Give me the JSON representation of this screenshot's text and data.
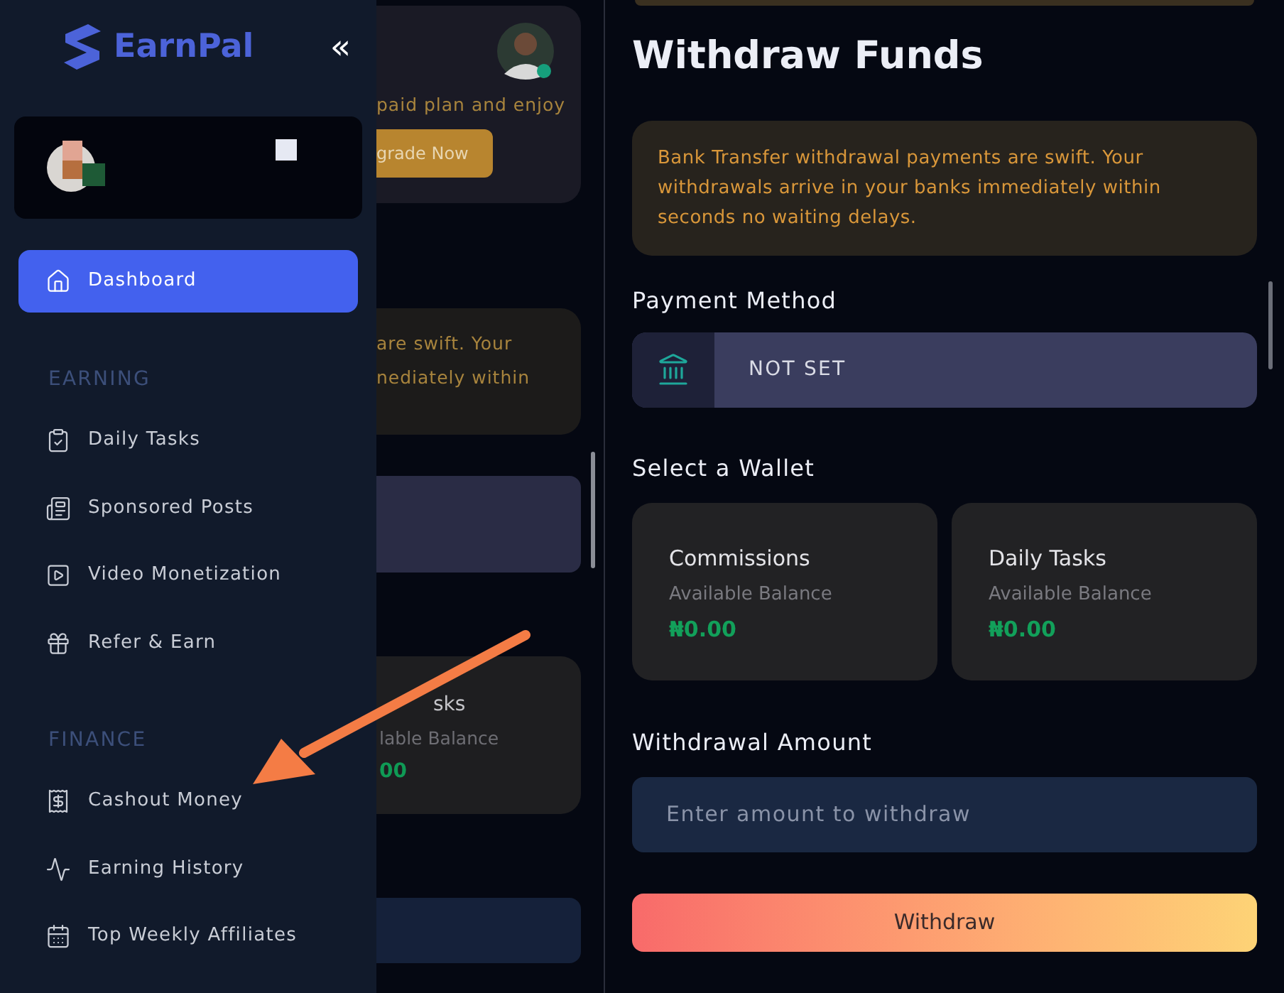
{
  "sidebar": {
    "brand": "EarnPal",
    "collapse_glyph": "«",
    "items": [
      {
        "kind": "item",
        "label": "Dashboard",
        "selected": true
      },
      {
        "kind": "section",
        "label": "EARNING"
      },
      {
        "kind": "item",
        "label": "Daily Tasks",
        "selected": false
      },
      {
        "kind": "item",
        "label": "Sponsored Posts",
        "selected": false
      },
      {
        "kind": "item",
        "label": "Video Monetization",
        "selected": false
      },
      {
        "kind": "item",
        "label": "Refer & Earn",
        "selected": false
      },
      {
        "kind": "section",
        "label": "FINANCE"
      },
      {
        "kind": "item",
        "label": "Cashout Money",
        "selected": false
      },
      {
        "kind": "item",
        "label": "Earning History",
        "selected": false
      },
      {
        "kind": "item",
        "label": "Top Weekly Affiliates",
        "selected": false
      }
    ]
  },
  "background_page": {
    "promo_text": "paid plan and enjoy",
    "upgrade_button": "grade Now",
    "notice_lines": [
      "are swift. Your",
      "nediately within"
    ],
    "wallet_title": "sks",
    "wallet_caption": "lable Balance",
    "wallet_amount": "00"
  },
  "withdraw": {
    "title": "Withdraw Funds",
    "notice": "Bank Transfer withdrawal payments are swift. Your withdrawals arrive in your banks immediately within seconds no waiting delays.",
    "payment_method_label": "Payment Method",
    "payment_method_value": "NOT SET",
    "wallet_label": "Select a Wallet",
    "wallets": [
      {
        "name": "Commissions",
        "caption": "Available Balance",
        "amount": "₦0.00"
      },
      {
        "name": "Daily Tasks",
        "caption": "Available Balance",
        "amount": "₦0.00"
      }
    ],
    "amount_label": "Withdrawal Amount",
    "amount_placeholder": "Enter amount to withdraw",
    "withdraw_button": "Withdraw"
  }
}
